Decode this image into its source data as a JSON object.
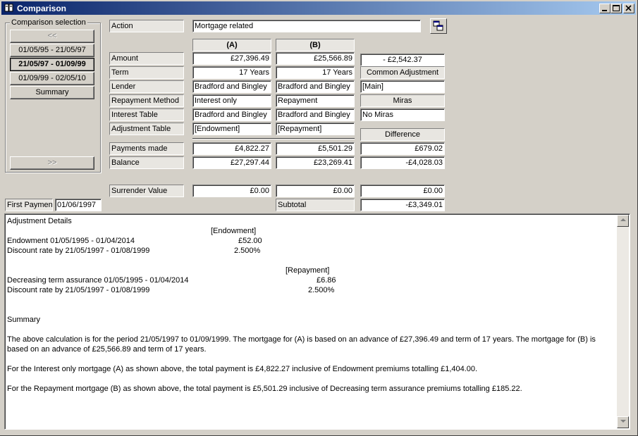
{
  "window": {
    "title": "Comparison",
    "icon": "book-icon",
    "controls": [
      "minimize-icon",
      "maximize-icon",
      "close-icon"
    ]
  },
  "comparison_selection": {
    "title": "Comparison selection",
    "prev_label": "<<",
    "next_label": ">>",
    "periods": [
      "01/05/95 - 21/05/97",
      "21/05/97 - 01/09/99",
      "01/09/99 - 02/05/10"
    ],
    "selected_period": "21/05/97 - 01/09/99",
    "summary_label": "Summary"
  },
  "action": {
    "label": "Action",
    "value": "Mortgage related",
    "button_icon": "compare-windows-icon"
  },
  "columns": {
    "a": "(A)",
    "b": "(B)"
  },
  "rows": {
    "amount": {
      "label": "Amount",
      "a": "£27,396.49",
      "b": "£25,566.89"
    },
    "term": {
      "label": "Term",
      "a": "17 Years",
      "b": "17 Years"
    },
    "lender": {
      "label": "Lender",
      "a": "Bradford and Bingley",
      "b": "Bradford and Bingley"
    },
    "repayment_method": {
      "label": "Repayment Method",
      "a": "Interest only",
      "b": "Repayment"
    },
    "interest_table": {
      "label": "Interest Table",
      "a": "Bradford and Bingley",
      "b": "Bradford and Bingley"
    },
    "adjustment_table": {
      "label": "Adjustment Table",
      "a": "[Endowment]",
      "b": "[Repayment]"
    },
    "payments_made": {
      "label": "Payments made",
      "a": "£4,822.27",
      "b": "£5,501.29",
      "difference": "£679.02"
    },
    "balance": {
      "label": "Balance",
      "a": "£27,297.44",
      "b": "£23,269.41",
      "difference": "-£4,028.03"
    },
    "surrender_value": {
      "label": "Surrender Value",
      "a": "£0.00",
      "b": "£0.00",
      "difference": "£0.00"
    }
  },
  "right_column": {
    "amount_difference": "- £2,542.37",
    "common_adjustment_label": "Common Adjustment",
    "common_adjustment_value": "[Main]",
    "miras_label": "Miras",
    "miras_value": "No Miras",
    "difference_label": "Difference"
  },
  "first_payment": {
    "label": "First Payment",
    "value": "01/06/1997"
  },
  "subtotal": {
    "label": "Subtotal",
    "value": "-£3,349.01"
  },
  "details": {
    "heading": "Adjustment Details",
    "endowment_header": "[Endowment]",
    "endowment_line1_label": "Endowment 01/05/1995 - 01/04/2014",
    "endowment_line1_value": "£52.00",
    "endowment_line2_label": "Discount rate by 21/05/1997 - 01/08/1999",
    "endowment_line2_value": "2.500%",
    "repayment_header": "[Repayment]",
    "repayment_line1_label": "Decreasing term assurance 01/05/1995 - 01/04/2014",
    "repayment_line1_value": "£6.86",
    "repayment_line2_label": "Discount rate by 21/05/1997 - 01/08/1999",
    "repayment_line2_value": "2.500%",
    "summary_heading": "Summary",
    "summary_para1": "The above calculation is for the period 21/05/1997 to 01/09/1999. The mortgage for (A) is based on an advance of £27,396.49 and term of 17 years. The mortgage for (B) is based on an advance of £25,566.89 and term of 17 years.",
    "summary_para2": "For the Interest only mortgage (A) as shown above, the total payment is £4,822.27 inclusive of Endowment premiums totalling £1,404.00.",
    "summary_para3": "For the Repayment mortgage (B) as shown above, the total payment is £5,501.29 inclusive of Decreasing term assurance premiums totalling £185.22."
  }
}
